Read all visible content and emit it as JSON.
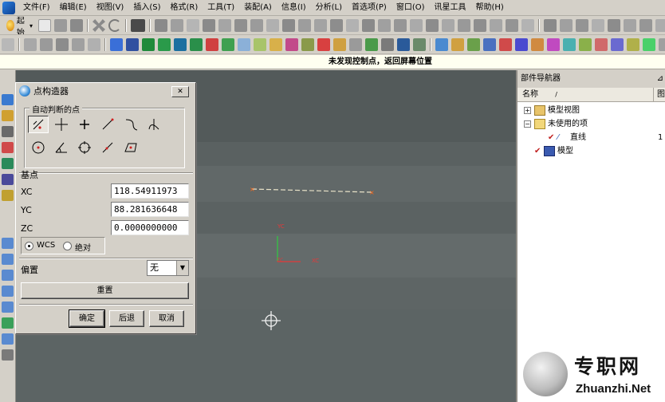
{
  "menubar": {
    "items": [
      "文件(F)",
      "编辑(E)",
      "视图(V)",
      "插入(S)",
      "格式(R)",
      "工具(T)",
      "装配(A)",
      "信息(I)",
      "分析(L)",
      "首选项(P)",
      "窗口(O)",
      "讯星工具",
      "帮助(H)"
    ]
  },
  "toolbar": {
    "start_label": "起始"
  },
  "status": {
    "message": "未发现控制点，返回屏幕位置"
  },
  "dialog": {
    "title": "点构造器",
    "close_label": "✕",
    "auto_group_label": "自动判断的点",
    "base_label": "基点",
    "xc_label": "XC",
    "yc_label": "YC",
    "zc_label": "ZC",
    "xc_value": "118.54911973",
    "yc_value": "88.281636648",
    "zc_value": "0.0000000000",
    "wcs_label": "WCS",
    "abs_label": "绝对",
    "offset_label": "偏置",
    "offset_value": "无",
    "reset_label": "重置",
    "ok_label": "确定",
    "back_label": "后退",
    "cancel_label": "取消"
  },
  "viewport": {
    "yc_axis_label": "YC",
    "xc_axis_label": "XC",
    "zc_axis_label": "ZC"
  },
  "navigator": {
    "title": "部件导航器",
    "col_name": "名称",
    "col_extra": "图",
    "items": [
      {
        "label": "模型视图",
        "count": ""
      },
      {
        "label": "未使用的项",
        "count": ""
      },
      {
        "label": "直线",
        "count": "1"
      },
      {
        "label": "模型",
        "count": ""
      }
    ]
  },
  "watermark": {
    "cn": "专职网",
    "en": "Zhuanzhi.Net"
  },
  "colors": {
    "viewport": "#4f5656",
    "line": "#e8e2c8",
    "axis_y": "#2ecc40",
    "axis_x": "#e23a3a",
    "endpoint": "#ff6a1a"
  }
}
